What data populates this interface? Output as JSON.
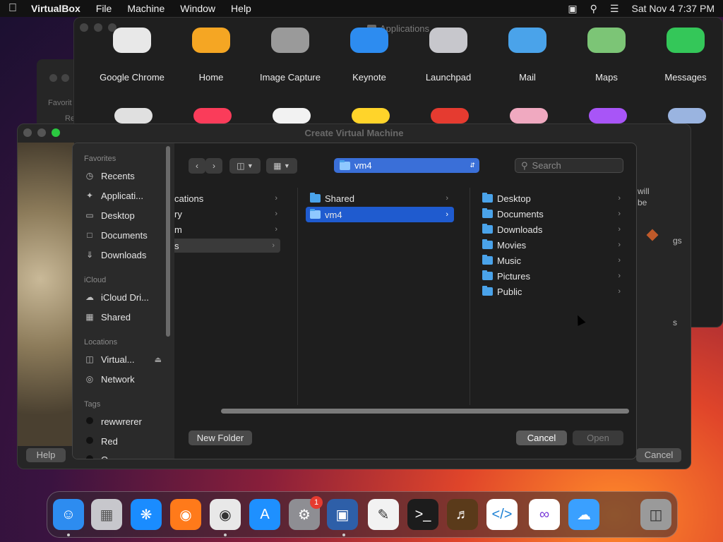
{
  "menubar": {
    "app": "VirtualBox",
    "items": [
      "File",
      "Machine",
      "Window",
      "Help"
    ],
    "clock": "Sat Nov 4  7:37 PM"
  },
  "apps_window": {
    "title": "Applications",
    "apps": [
      {
        "label": "Google Chrome",
        "color": "#e8e8e8"
      },
      {
        "label": "Home",
        "color": "#f5a623"
      },
      {
        "label": "Image Capture",
        "color": "#9a9a9a"
      },
      {
        "label": "Keynote",
        "color": "#2d8cf0"
      },
      {
        "label": "Launchpad",
        "color": "#c7c7cc"
      },
      {
        "label": "Mail",
        "color": "#4aa3ea"
      },
      {
        "label": "Maps",
        "color": "#7cc576"
      },
      {
        "label": "Messages",
        "color": "#34c759"
      }
    ],
    "row2_colors": [
      "#e0e0e0",
      "#fa3c5a",
      "#f2f2f2",
      "#ffd42a",
      "#e53b30",
      "#f0a9c0",
      "#a855f7",
      "#9ab4e0"
    ]
  },
  "background_window": {
    "favorites": "Favorit",
    "partial": "Re"
  },
  "cvm_window": {
    "title": "Create Virtual Machine",
    "help_button": "Help",
    "cancel_button": "Cancel",
    "side_text": [
      "will",
      "be",
      "gs",
      "s"
    ]
  },
  "dialog": {
    "sidebar": {
      "favorites_heading": "Favorites",
      "favorites": [
        {
          "label": "Recents",
          "icon": "clock-icon"
        },
        {
          "label": "Applicati...",
          "icon": "apps-icon"
        },
        {
          "label": "Desktop",
          "icon": "desktop-icon"
        },
        {
          "label": "Documents",
          "icon": "document-icon"
        },
        {
          "label": "Downloads",
          "icon": "download-icon"
        }
      ],
      "icloud_heading": "iCloud",
      "icloud": [
        {
          "label": "iCloud Dri...",
          "icon": "cloud-icon"
        },
        {
          "label": "Shared",
          "icon": "shared-folder-icon"
        }
      ],
      "locations_heading": "Locations",
      "locations": [
        {
          "label": "Virtual...",
          "icon": "disk-icon"
        },
        {
          "label": "Network",
          "icon": "globe-icon"
        }
      ],
      "tags_heading": "Tags",
      "tags": [
        {
          "label": "rewwrerer",
          "color": "#111111"
        },
        {
          "label": "Red",
          "color": "#111111"
        },
        {
          "label": "O",
          "color": "#111111"
        }
      ]
    },
    "path": "vm4",
    "search_placeholder": "Search",
    "col1": [
      "cations",
      "ry",
      "m",
      "s"
    ],
    "col2": [
      "Shared",
      "vm4"
    ],
    "col3": [
      "Desktop",
      "Documents",
      "Downloads",
      "Movies",
      "Music",
      "Pictures",
      "Public"
    ],
    "new_folder": "New Folder",
    "cancel": "Cancel",
    "open": "Open"
  },
  "dock": {
    "icons": [
      {
        "name": "finder-icon",
        "color": "#2d8cf0"
      },
      {
        "name": "launchpad-icon",
        "color": "#c7c7cc"
      },
      {
        "name": "safari-icon",
        "color": "#1a8cff"
      },
      {
        "name": "firefox-icon",
        "color": "#ff7a1a"
      },
      {
        "name": "chrome-icon",
        "color": "#e8e8e8"
      },
      {
        "name": "app-store-icon",
        "color": "#1e90ff"
      },
      {
        "name": "system-settings-icon",
        "color": "#8e8e93",
        "badge": "1"
      },
      {
        "name": "virtualbox-icon",
        "color": "#2e5fa8"
      },
      {
        "name": "textedit-icon",
        "color": "#f2f2f2"
      },
      {
        "name": "terminal-icon",
        "color": "#1c1c1c"
      },
      {
        "name": "garageband-icon",
        "color": "#5a3a1a"
      },
      {
        "name": "vscode-icon",
        "color": "#ffffff"
      },
      {
        "name": "visual-studio-icon",
        "color": "#ffffff"
      },
      {
        "name": "weather-icon",
        "color": "#3aa0ff"
      },
      {
        "name": "trash-icon",
        "color": "#9a9a9a"
      }
    ]
  }
}
